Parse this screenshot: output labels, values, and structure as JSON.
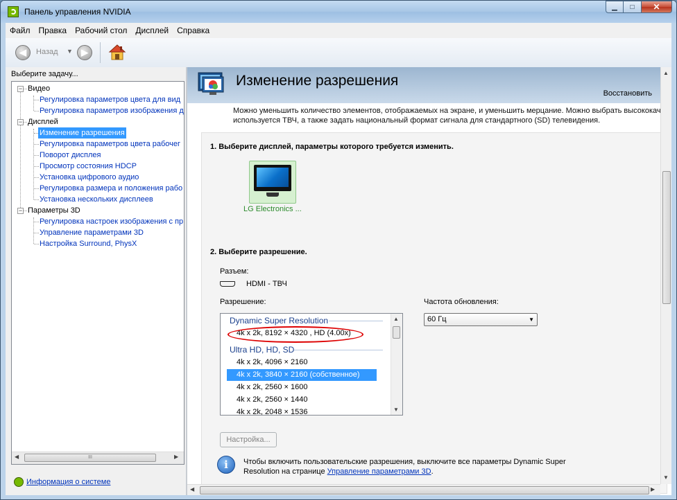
{
  "window": {
    "title": "Панель управления NVIDIA",
    "min_glyph": "▁",
    "max_glyph": "□",
    "close_glyph": "✕"
  },
  "menubar": [
    "Файл",
    "Правка",
    "Рабочий стол",
    "Дисплей",
    "Справка"
  ],
  "toolbar": {
    "back_label": "Назад",
    "back_glyph": "◀",
    "forward_glyph": "▶",
    "dropdown_glyph": "▼"
  },
  "sidebar": {
    "prompt": "Выберите задачу...",
    "categories": [
      {
        "label": "Видео",
        "items": [
          "Регулировка параметров цвета для вид",
          "Регулировка параметров изображения д"
        ]
      },
      {
        "label": "Дисплей",
        "items": [
          "Изменение разрешения",
          "Регулировка параметров цвета рабочег",
          "Поворот дисплея",
          "Просмотр состояния HDCP",
          "Установка цифрового аудио",
          "Регулировка размера и положения рабо",
          "Установка нескольких дисплеев"
        ]
      },
      {
        "label": "Параметры 3D",
        "items": [
          "Регулировка настроек изображения с пр",
          "Управление параметрами 3D",
          "Настройка Surround, PhysX"
        ]
      }
    ],
    "selected": "Изменение разрешения",
    "expander_glyph": "−",
    "scroll_glyph": "III",
    "system_info_link": "Информация о системе"
  },
  "page": {
    "title": "Изменение разрешения",
    "restore_label": "Восстановить",
    "description_lines": [
      "Можно уменьшить количество элементов, отображаемых на экране, и уменьшить мерцание. Можно выбрать высококач",
      "используется ТВЧ, а также задать национальный формат сигнала для стандартного (SD) телевидения."
    ],
    "step1": "1. Выберите дисплей, параметры которого требуется изменить.",
    "display_name": "LG Electronics ...",
    "step2": "2. Выберите разрешение.",
    "connector_label": "Разъем:",
    "connector_value": "HDMI - ТВЧ",
    "resolution_label": "Разрешение:",
    "refresh_label": "Частота обновления:",
    "refresh_value": "60 Гц",
    "resolution_groups": [
      {
        "label": "Dynamic Super Resolution",
        "items": [
          "4k x 2k, 8192 × 4320 , HD (4.00x)"
        ]
      },
      {
        "label": "Ultra HD, HD, SD",
        "items": [
          "4k x 2k, 4096 × 2160",
          "4k x 2k, 3840 × 2160 (собственное)",
          "4k x 2k, 2560 × 1600",
          "4k x 2k, 2560 × 1440",
          "4k x 2k, 2048 × 1536"
        ]
      }
    ],
    "selected_resolution": "4k x 2k, 3840 × 2160 (собственное)",
    "customize_button": "Настройка...",
    "info_glyph": "i",
    "info_text": "Чтобы включить пользовательские разрешения, выключите все параметры Dynamic Super Resolution на странице",
    "info_link": "Управление параметрами 3D",
    "info_tail": "."
  },
  "colors": {
    "accent": "#3399ff",
    "link": "#0033bb",
    "nvidia_green": "#76b900",
    "annotation_red": "#dd0000"
  },
  "icons": [
    "nvidia-logo-icon",
    "back-arrow-icon",
    "forward-arrow-icon",
    "home-icon",
    "monitor-icon",
    "hdmi-icon",
    "info-icon"
  ]
}
